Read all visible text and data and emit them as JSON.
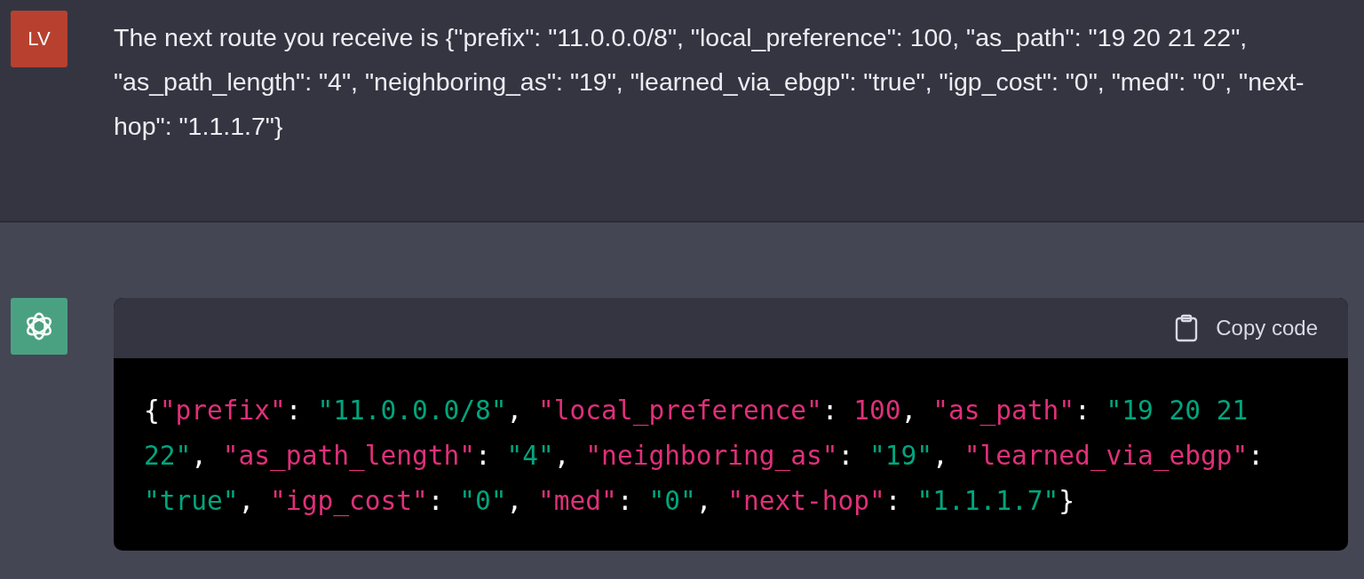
{
  "user_message": {
    "avatar": "LV",
    "text": "The next route you receive is {\"prefix\": \"11.0.0.0/8\", \"local_preference\": 100, \"as_path\": \"19 20 21 22\", \"as_path_length\": \"4\", \"neighboring_as\": \"19\", \"learned_via_ebgp\": \"true\", \"igp_cost\": \"0\", \"med\": \"0\", \"next-hop\": \"1.1.1.7\"}"
  },
  "assistant_message": {
    "code_block": {
      "copy_button": "Copy code",
      "lines": [
        [
          {
            "kind": "punct",
            "text": "{"
          },
          {
            "kind": "key",
            "text": "\"prefix\""
          },
          {
            "kind": "punct",
            "text": ": "
          },
          {
            "kind": "string",
            "text": "\"11.0.0.0/8\""
          },
          {
            "kind": "punct",
            "text": ", "
          },
          {
            "kind": "key",
            "text": "\"local_preference\""
          },
          {
            "kind": "punct",
            "text": ": "
          },
          {
            "kind": "number",
            "text": "100"
          },
          {
            "kind": "punct",
            "text": ", "
          },
          {
            "kind": "key",
            "text": "\"as_path\""
          },
          {
            "kind": "punct",
            "text": ": "
          },
          {
            "kind": "string",
            "text": "\"19 20 21"
          }
        ],
        [
          {
            "kind": "string",
            "text": "22\""
          },
          {
            "kind": "punct",
            "text": ", "
          },
          {
            "kind": "key",
            "text": "\"as_path_length\""
          },
          {
            "kind": "punct",
            "text": ": "
          },
          {
            "kind": "string",
            "text": "\"4\""
          },
          {
            "kind": "punct",
            "text": ", "
          },
          {
            "kind": "key",
            "text": "\"neighboring_as\""
          },
          {
            "kind": "punct",
            "text": ": "
          },
          {
            "kind": "string",
            "text": "\"19\""
          },
          {
            "kind": "punct",
            "text": ", "
          },
          {
            "kind": "key",
            "text": "\"learned_via_ebgp\""
          },
          {
            "kind": "punct",
            "text": ":"
          }
        ],
        [
          {
            "kind": "string",
            "text": "\"true\""
          },
          {
            "kind": "punct",
            "text": ", "
          },
          {
            "kind": "key",
            "text": "\"igp_cost\""
          },
          {
            "kind": "punct",
            "text": ": "
          },
          {
            "kind": "string",
            "text": "\"0\""
          },
          {
            "kind": "punct",
            "text": ", "
          },
          {
            "kind": "key",
            "text": "\"med\""
          },
          {
            "kind": "punct",
            "text": ": "
          },
          {
            "kind": "string",
            "text": "\"0\""
          },
          {
            "kind": "punct",
            "text": ", "
          },
          {
            "kind": "key",
            "text": "\"next-hop\""
          },
          {
            "kind": "punct",
            "text": ": "
          },
          {
            "kind": "string",
            "text": "\"1.1.1.7\""
          },
          {
            "kind": "punct",
            "text": "}"
          }
        ]
      ]
    }
  }
}
